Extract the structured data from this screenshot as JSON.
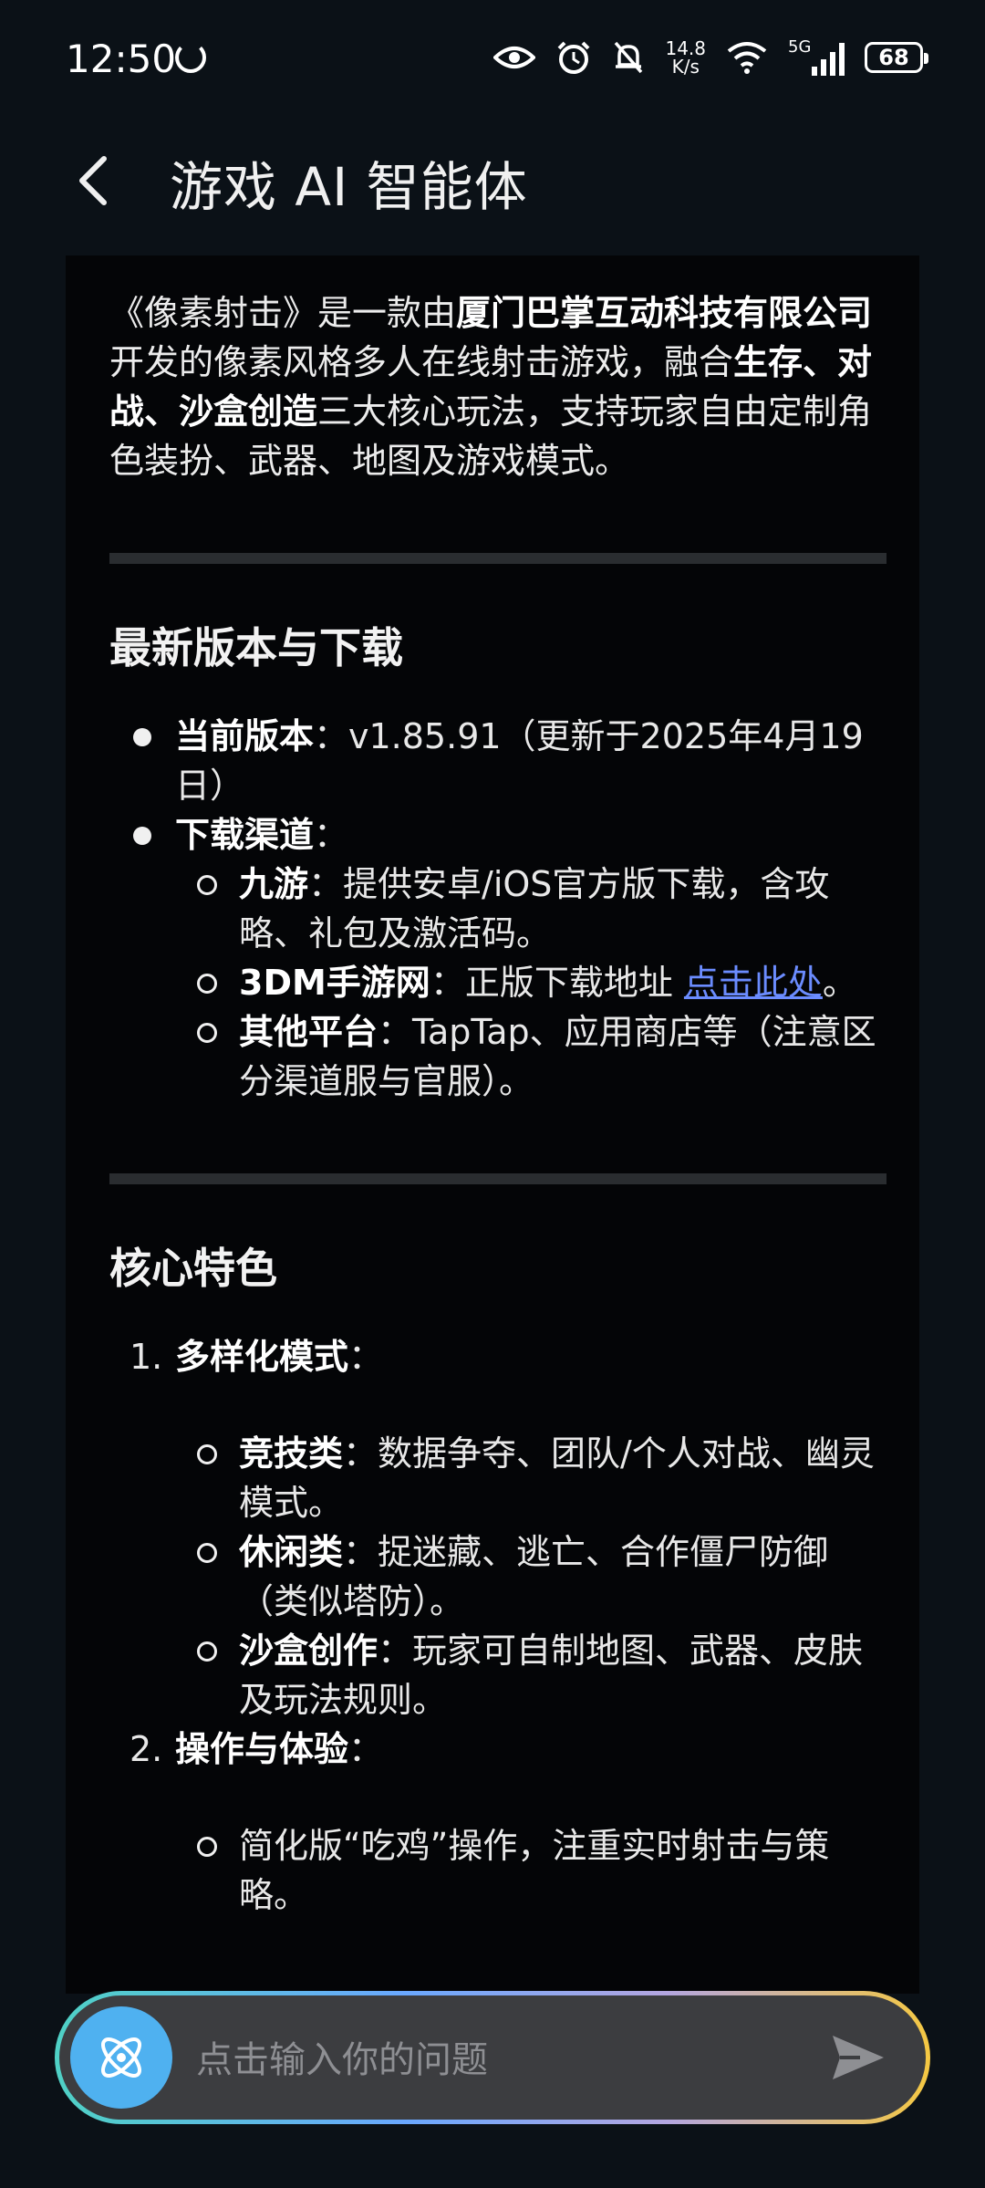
{
  "status_bar": {
    "time": "12:50",
    "net_speed_value": "14.8",
    "net_speed_unit": "K/s",
    "network": "5G",
    "battery": "68"
  },
  "header": {
    "title": "游戏 AI 智能体"
  },
  "content": {
    "intro": {
      "t1": "《像素射击》是一款由",
      "b1": "厦门巴掌互动科技有限公司",
      "t2": "开发的像素风格多人在线射击游戏，融合",
      "b2": "生存、对战、沙盒创造",
      "t3": "三大核心玩法，支持玩家自由定制角色装扮、武器、地图及游戏模式。"
    },
    "section1": {
      "heading": "最新版本与下载",
      "version_label": "当前版本",
      "version_text": "：v1.85.91（更新于2025年4月19日）",
      "channels_label": "下载渠道",
      "channels_colon": "：",
      "ch1_label": "九游",
      "ch1_text": "：提供安卓/iOS官方版下载，含攻略、礼包及激活码。",
      "ch2_label": "3DM手游网",
      "ch2_text": "：正版下载地址 ",
      "ch2_link": "点击此处",
      "ch2_end": "。",
      "ch3_label": "其他平台",
      "ch3_text": "：TapTap、应用商店等（注意区分渠道服与官服）。"
    },
    "section2": {
      "heading": "核心特色",
      "item1_num": "1.",
      "item1_label": "多样化模式",
      "item1_colon": "：",
      "m1_label": "竞技类",
      "m1_text": "：数据争夺、团队/个人对战、幽灵模式。",
      "m2_label": "休闲类",
      "m2_text": "：捉迷藏、逃亡、合作僵尸防御（类似塔防）。",
      "m3_label": "沙盒创作",
      "m3_text": "：玩家可自制地图、武器、皮肤及玩法规则。",
      "item2_num": "2.",
      "item2_label": "操作与体验",
      "item2_colon": "：",
      "e1_text": "简化版“吃鸡”操作，注重实时射击与策略。"
    }
  },
  "input": {
    "placeholder": "点击输入你的问题"
  },
  "colors": {
    "link": "#6b8cff",
    "accent_button": "#4fb1f0"
  }
}
